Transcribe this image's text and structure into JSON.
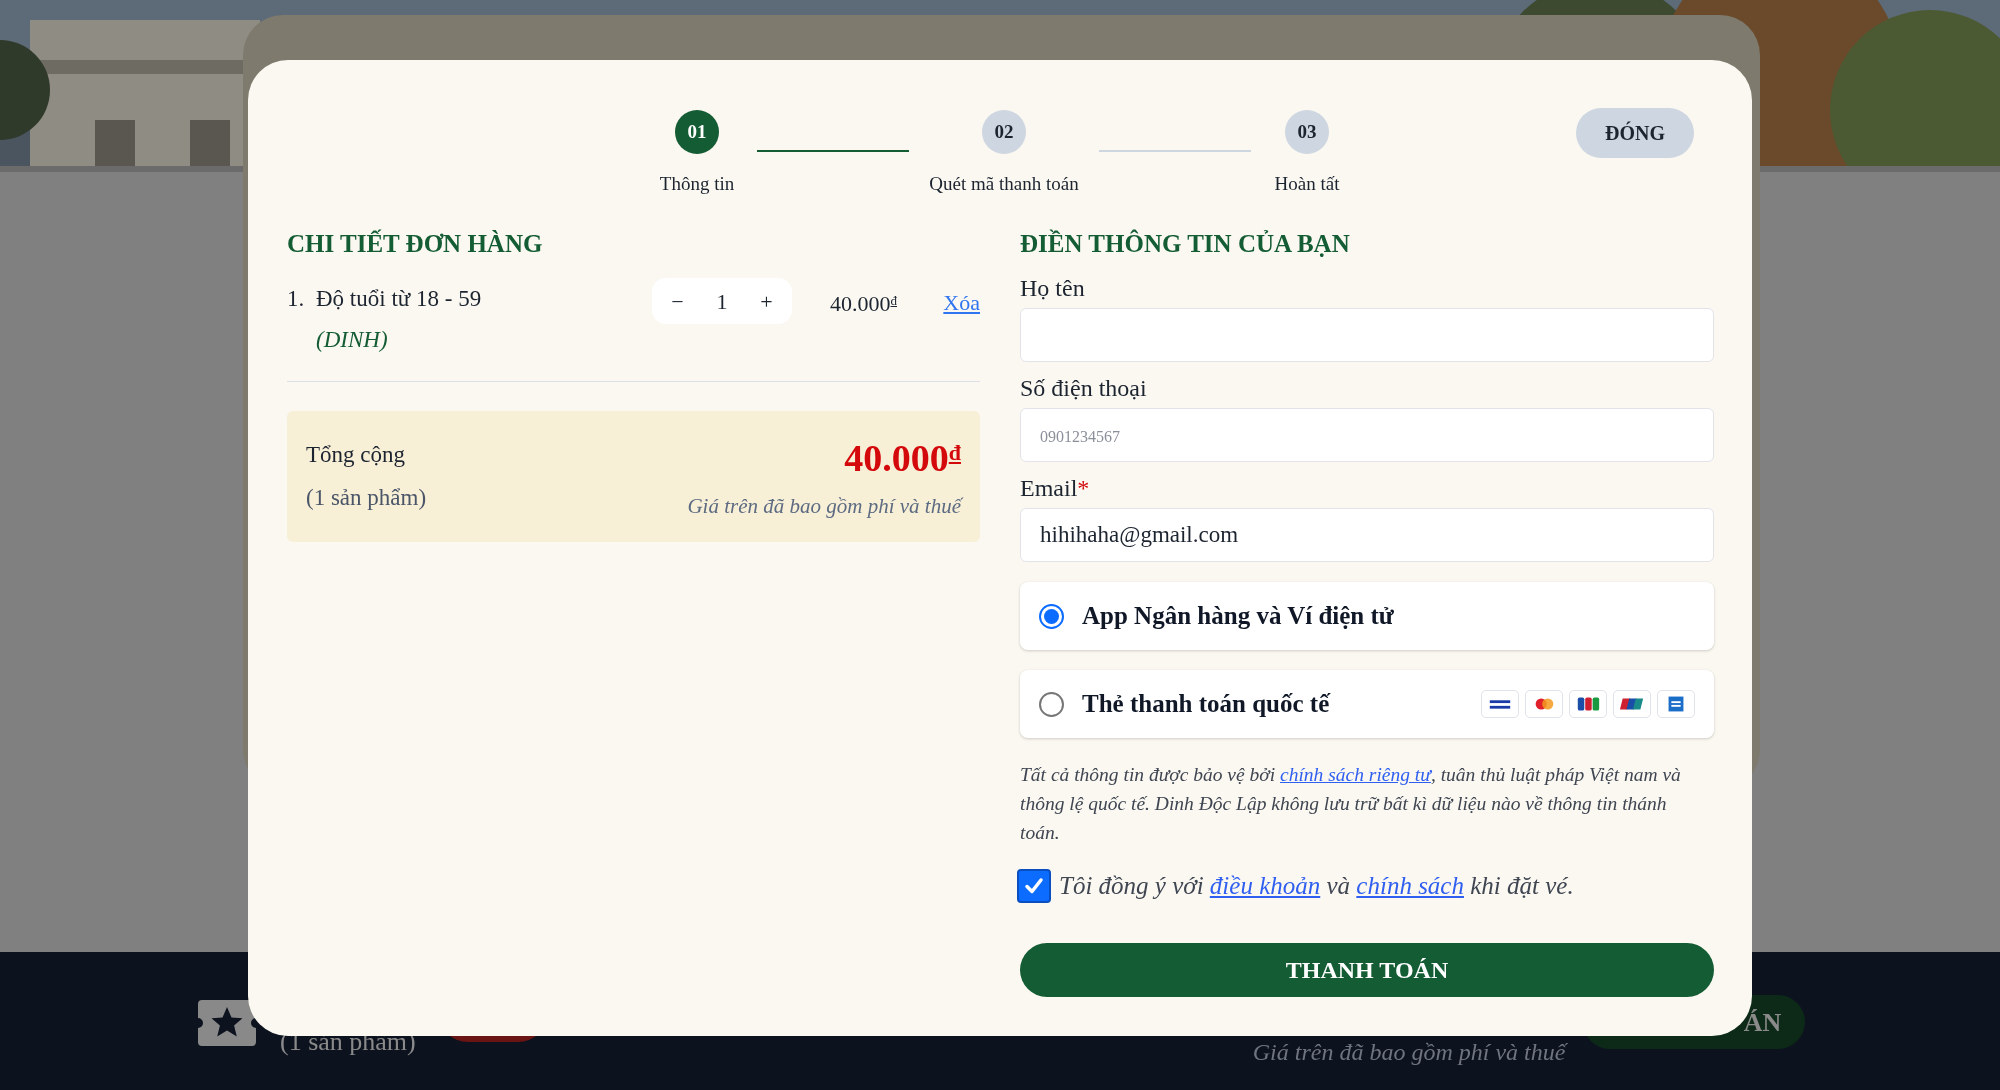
{
  "background": {
    "summary_count": "(1 sản phẩm)",
    "summary_note": "Giá trên đã bao gồm phí và thuế",
    "button_fragment": "ÁN"
  },
  "steps": [
    {
      "number": "01",
      "label": "Thông tin",
      "selected": true
    },
    {
      "number": "02",
      "label": "Quét mã thanh toán",
      "selected": false
    },
    {
      "number": "03",
      "label": "Hoàn tất",
      "selected": false
    }
  ],
  "close_button": "ĐÓNG",
  "order": {
    "title": "CHI TIẾT ĐƠN HÀNG",
    "items": [
      {
        "index": "1.",
        "name": "Độ tuổi từ 18 - 59",
        "venue": "(DINH)",
        "minus": "−",
        "quantity": "1",
        "plus": "+",
        "price": "40.000",
        "currency": "đ",
        "remove": "Xóa"
      }
    ],
    "total": {
      "label": "Tổng cộng",
      "count": "(1 sản phẩm)",
      "amount": "40.000",
      "currency": "đ",
      "note": "Giá trên đã bao gồm phí và thuế"
    }
  },
  "form": {
    "title": "ĐIỀN THÔNG TIN CỦA BẠN",
    "fields": [
      {
        "label": "Họ tên"
      },
      {
        "label": "Số điện thoại",
        "placeholder": "0901234567"
      },
      {
        "label": "Email",
        "required_mark": "*",
        "value": "hihihaha@gmail.com"
      }
    ],
    "payment_methods": [
      {
        "label": "App Ngân hàng và Ví điện tử",
        "selected": true,
        "kind": "plain"
      },
      {
        "label": "Thẻ thanh toán quốc tế",
        "selected": false,
        "kind": "cards"
      }
    ],
    "notice": {
      "before": "Tất cả thông tin được bảo vệ bởi",
      "link": "chính sách riêng tư",
      "after": ", tuân thủ luật pháp Việt nam và thông lệ quốc tế. Dinh Độc Lập không lưu trữ bất kì dữ liệu nào về thông tin thánh toán."
    },
    "agree": {
      "checked": true,
      "before": "Tôi đồng ý với",
      "link_1": "điều khoản",
      "middle": "và",
      "link_2": "chính sách",
      "after": "khi đặt vé."
    },
    "submit": "THANH TOÁN"
  }
}
